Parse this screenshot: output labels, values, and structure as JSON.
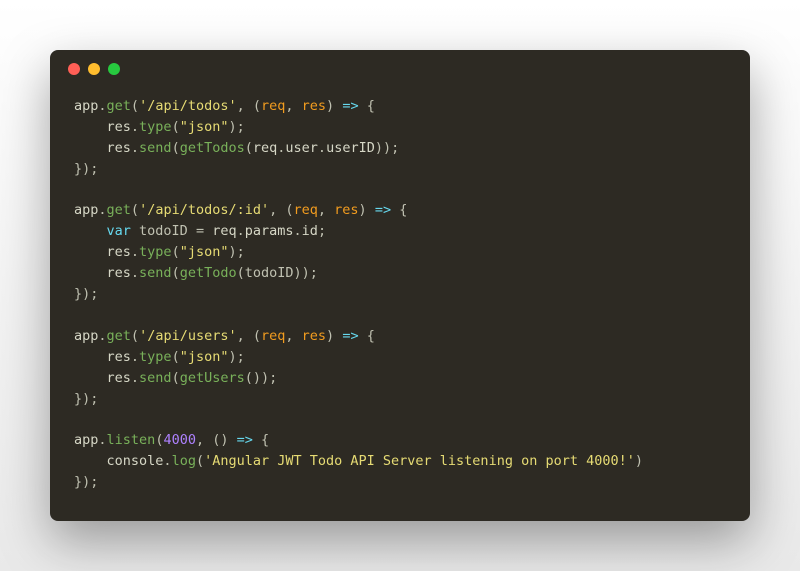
{
  "code": {
    "l1": {
      "obj": "app",
      "dot1": ".",
      "fn": "get",
      "p1": "(",
      "route": "'/api/todos'",
      "c1": ", (",
      "a1": "req",
      "c2": ", ",
      "a2": "res",
      "p2": ") ",
      "arrow": "=>",
      "brace": " {"
    },
    "l2": {
      "indent": "    ",
      "obj": "res",
      "dot": ".",
      "fn": "type",
      "p1": "(",
      "arg": "\"json\"",
      "p2": ");"
    },
    "l3": {
      "indent": "    ",
      "obj": "res",
      "dot": ".",
      "fn": "send",
      "p1": "(",
      "call": "getTodos",
      "p2": "(",
      "o2": "req",
      "d2": ".",
      "p3": "user",
      "d3": ".",
      "p4": "userID",
      "end": "));"
    },
    "l4": {
      "text": "});"
    },
    "l5": {
      "text": ""
    },
    "l6": {
      "obj": "app",
      "dot1": ".",
      "fn": "get",
      "p1": "(",
      "route": "'/api/todos/:id'",
      "c1": ", (",
      "a1": "req",
      "c2": ", ",
      "a2": "res",
      "p2": ") ",
      "arrow": "=>",
      "brace": " {"
    },
    "l7": {
      "indent": "    ",
      "kw": "var",
      "sp": " ",
      "name": "todoID",
      "eq": " = ",
      "obj": "req",
      "d1": ".",
      "p1": "params",
      "d2": ".",
      "p2": "id",
      "end": ";"
    },
    "l8": {
      "indent": "    ",
      "obj": "res",
      "dot": ".",
      "fn": "type",
      "p1": "(",
      "arg": "\"json\"",
      "p2": ");"
    },
    "l9": {
      "indent": "    ",
      "obj": "res",
      "dot": ".",
      "fn": "send",
      "p1": "(",
      "call": "getTodo",
      "p2": "(",
      "arg": "todoID",
      "end": "));"
    },
    "l10": {
      "text": "});"
    },
    "l11": {
      "text": ""
    },
    "l12": {
      "obj": "app",
      "dot1": ".",
      "fn": "get",
      "p1": "(",
      "route": "'/api/users'",
      "c1": ", (",
      "a1": "req",
      "c2": ", ",
      "a2": "res",
      "p2": ") ",
      "arrow": "=>",
      "brace": " {"
    },
    "l13": {
      "indent": "    ",
      "obj": "res",
      "dot": ".",
      "fn": "type",
      "p1": "(",
      "arg": "\"json\"",
      "p2": ");"
    },
    "l14": {
      "indent": "    ",
      "obj": "res",
      "dot": ".",
      "fn": "send",
      "p1": "(",
      "call": "getUsers",
      "p2": "()",
      "end": ");"
    },
    "l15": {
      "text": "});"
    },
    "l16": {
      "text": ""
    },
    "l17": {
      "obj": "app",
      "dot1": ".",
      "fn": "listen",
      "p1": "(",
      "num": "4000",
      "c1": ", () ",
      "arrow": "=>",
      "brace": " {"
    },
    "l18": {
      "indent": "    ",
      "obj": "console",
      "dot": ".",
      "fn": "log",
      "p1": "(",
      "str": "'Angular JWT Todo API Server listening on port 4000!'",
      "p2": ")"
    },
    "l19": {
      "text": "});"
    }
  }
}
